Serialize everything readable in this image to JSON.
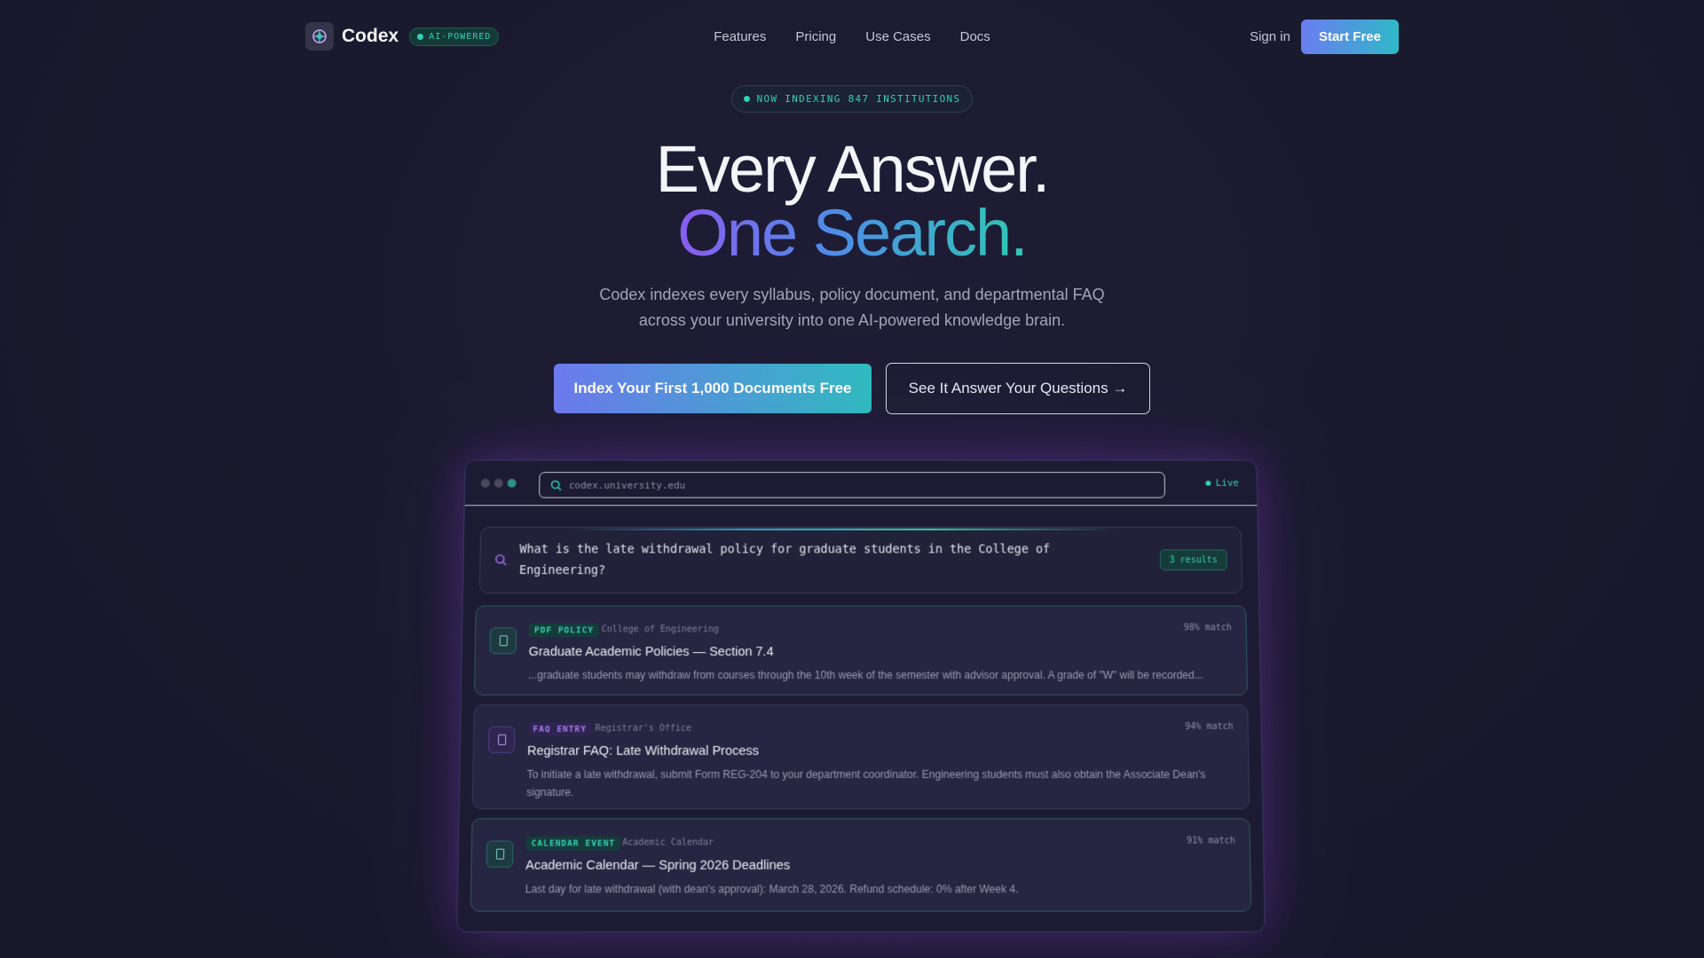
{
  "nav": {
    "brand": "Codex",
    "badge": "AI-POWERED",
    "links": [
      "Features",
      "Pricing",
      "Use Cases",
      "Docs"
    ],
    "signin": "Sign in",
    "start": "Start Free"
  },
  "hero": {
    "pill": "NOW INDEXING 847 INSTITUTIONS",
    "line1": "Every Answer.",
    "line2": "One Search.",
    "sub1": "Codex indexes every syllabus, policy document, and departmental FAQ",
    "sub2": "across your university into one AI-powered knowledge brain.",
    "cta_primary": "Index Your First 1,000 Documents Free",
    "cta_secondary": "See It Answer Your Questions →"
  },
  "preview": {
    "url": "codex.university.edu",
    "live": "Live",
    "query": "What is the late withdrawal policy for graduate students in the College of Engineering?",
    "results_count": "3 results",
    "results": [
      {
        "tag": "PDF POLICY",
        "tag_color": "#2fd3b4",
        "dept": "College of Engineering",
        "match": "98% match",
        "title": "Graduate Academic Policies — Section 7.4",
        "excerpt": "...graduate students may withdraw from courses through the 10th week of the semester with advisor approval. A grade of \"W\" will be recorded..."
      },
      {
        "tag": "FAQ ENTRY",
        "tag_color": "#a97cf0",
        "dept": "Registrar's Office",
        "match": "94% match",
        "title": "Registrar FAQ: Late Withdrawal Process",
        "excerpt": "To initiate a late withdrawal, submit Form REG-204 to your department coordinator. Engineering students must also obtain the Associate Dean's signature."
      },
      {
        "tag": "CALENDAR EVENT",
        "tag_color": "#2fd3b4",
        "dept": "Academic Calendar",
        "match": "91% match",
        "title": "Academic Calendar — Spring 2026 Deadlines",
        "excerpt": "Last day for late withdrawal (with dean's approval): March 28, 2026. Refund schedule: 0% after Week 4."
      }
    ]
  }
}
